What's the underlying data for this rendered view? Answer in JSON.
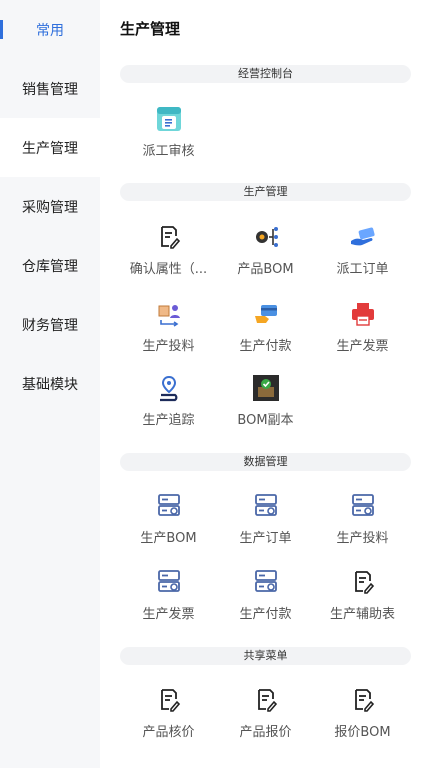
{
  "sidebar": {
    "items": [
      {
        "label": "常用"
      },
      {
        "label": "销售管理"
      },
      {
        "label": "生产管理"
      },
      {
        "label": "采购管理"
      },
      {
        "label": "仓库管理"
      },
      {
        "label": "财务管理"
      },
      {
        "label": "基础模块"
      }
    ]
  },
  "page": {
    "title": "生产管理"
  },
  "sections": [
    {
      "title": "经营控制台",
      "items": [
        {
          "label": "派工审核",
          "icon": "document-badge-icon"
        }
      ]
    },
    {
      "title": "生产管理",
      "items": [
        {
          "label": "确认属性（...",
          "icon": "edit-doc-icon"
        },
        {
          "label": "产品BOM",
          "icon": "bom-gear-icon"
        },
        {
          "label": "派工订单",
          "icon": "hand-card-icon"
        },
        {
          "label": "生产投料",
          "icon": "box-person-icon"
        },
        {
          "label": "生产付款",
          "icon": "card-payment-icon"
        },
        {
          "label": "生产发票",
          "icon": "printer-icon"
        },
        {
          "label": "生产追踪",
          "icon": "location-track-icon"
        },
        {
          "label": "BOM副本",
          "icon": "photo-thumbnail-icon"
        }
      ]
    },
    {
      "title": "数据管理",
      "items": [
        {
          "label": "生产BOM",
          "icon": "server-icon"
        },
        {
          "label": "生产订单",
          "icon": "server-icon"
        },
        {
          "label": "生产投料",
          "icon": "server-icon"
        },
        {
          "label": "生产发票",
          "icon": "server-icon"
        },
        {
          "label": "生产付款",
          "icon": "server-icon"
        },
        {
          "label": "生产辅助表",
          "icon": "edit-doc-icon"
        }
      ]
    },
    {
      "title": "共享菜单",
      "items": [
        {
          "label": "产品核价",
          "icon": "edit-doc-icon"
        },
        {
          "label": "产品报价",
          "icon": "edit-doc-icon"
        },
        {
          "label": "报价BOM",
          "icon": "edit-doc-icon"
        }
      ]
    }
  ],
  "colors": {
    "accent": "#2f6fdc",
    "icon_blue": "#4a67a8",
    "sidebar_bg": "#f6f7f9"
  }
}
